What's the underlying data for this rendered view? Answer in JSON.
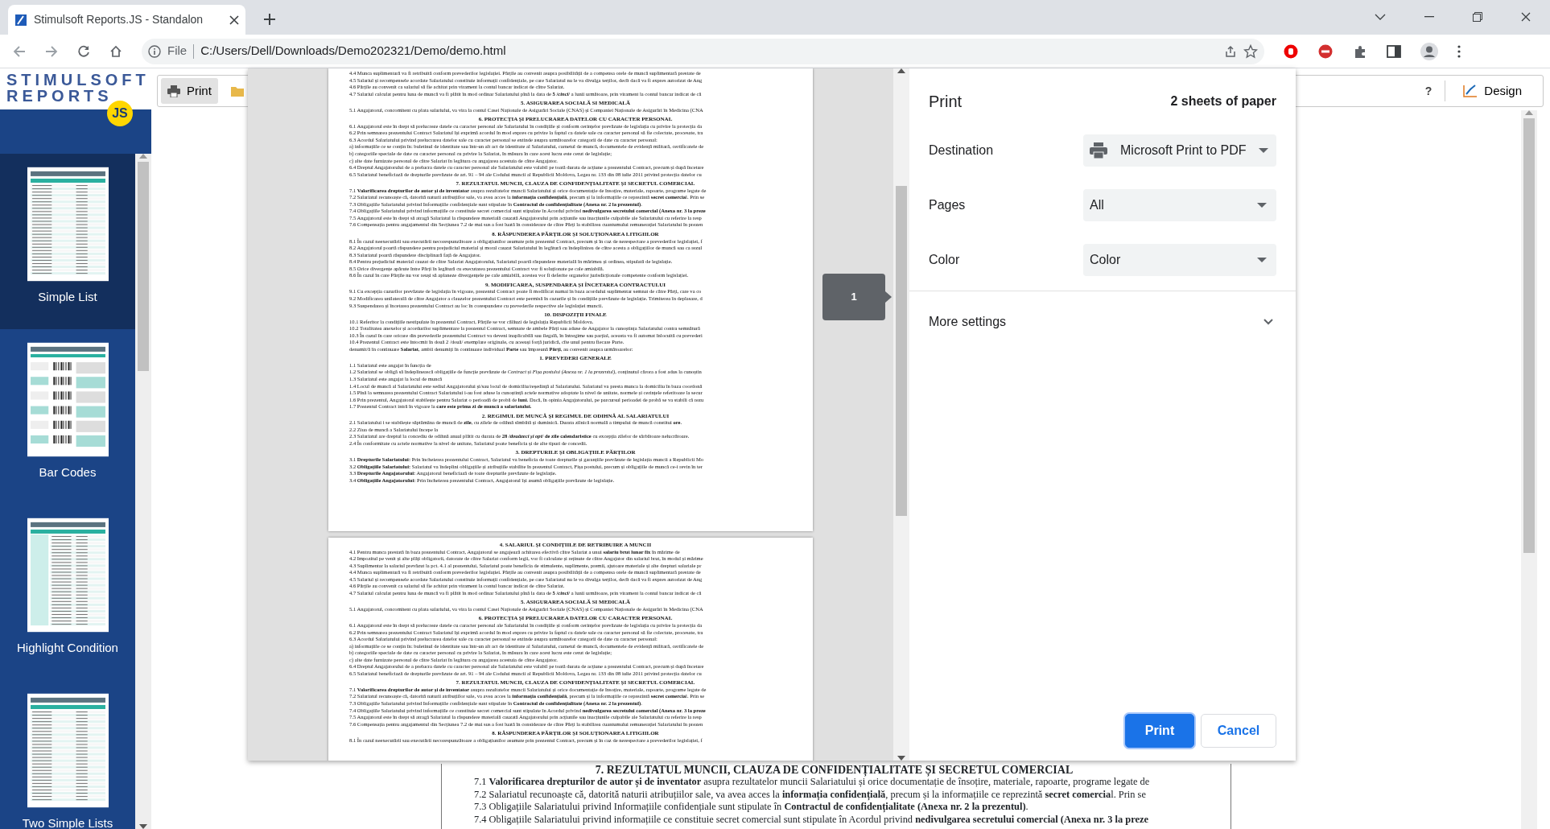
{
  "browser": {
    "tab_title": "Stimulsoft Reports.JS - Standalon",
    "scheme": "File",
    "url": "C:/Users/Dell/Downloads/Demo202321/Demo/demo.html"
  },
  "sidebar": {
    "logo_line1": "STIMULSOFT",
    "logo_line2": "REPORTS",
    "logo_badge": "JS",
    "items": [
      {
        "label": "Simple List",
        "selected": true,
        "kind": "list"
      },
      {
        "label": "Bar Codes",
        "selected": false,
        "kind": "barcodes"
      },
      {
        "label": "Highlight Condition",
        "selected": false,
        "kind": "grouped"
      },
      {
        "label": "Two Simple Lists",
        "selected": false,
        "kind": "list"
      }
    ]
  },
  "toolbar": {
    "print": "Print",
    "help": "?",
    "design": "Design"
  },
  "document": {
    "lines": [
      {
        "kind": "heading",
        "text": "7. REZULTATUL MUNCII, CLAUZA DE CONFIDENȚIALITATE ȘI SECRETUL COMERCIAL"
      },
      {
        "kind": "text",
        "text": "7.1 **Valorificarea drepturilor de autor și de inventator** asupra rezultatelor muncii Salariatului și orice documentație de însoțire, materiale, rapoarte, programe legate de"
      },
      {
        "kind": "text",
        "text": "7.2 Salariatul recunoaște că, datorită naturii atribuțiilor sale, va avea acces la **informația confidențială**, precum și la informațiile ce reprezintă **secret comercia**l. Prin se"
      },
      {
        "kind": "text",
        "text": "7.3 Obligațiile Salariatului privind Informațiile confidențiale sunt stipulate în **Contractul de confidențialitate (Anexa nr. 2 la prezentul)**."
      },
      {
        "kind": "text",
        "text": "7.4 Obligațiile Salariatului privind informațiile ce constituie secret comercial sunt stipulate în Acordul privind **nedivulgarea secretului comercial (Anexa nr. 3 la preze**"
      }
    ]
  },
  "print_preview": {
    "page_number": "1",
    "pages": [
      {
        "lines": [
          {
            "kind": "text",
            "text": "4.4 Munca suplimentară va fi retribuită conform prevederilor legislației. Părțile au convenit asupra posibilității de a compensa orele de muncă suplimentară prestate de"
          },
          {
            "kind": "text",
            "text": "4.5 Salariul și recompensele acordate Salariatului constituie informații confidențiale, pe care Salariatul nu le va divulga terților, decît dacă va fi expres autorizat de Ang"
          },
          {
            "kind": "text",
            "text": "4.6 Părțile au convenit ca salariul să fie achitat prin virament la contul bancar indicat de către Salariat."
          },
          {
            "kind": "text",
            "text": "4.7 Salariul calculat pentru luna de muncă va fi plătit în mod ordinar Salariatului pînă la data de **5 /*cinci*/** a lunii următoare, prin virament la contul bancar indicat de că"
          },
          {
            "kind": "heading",
            "text": "5. ASIGURAREA SOCIALĂ SI MEDICALĂ"
          },
          {
            "kind": "text",
            "text": "5.1 Angajatorul, concomitent cu plata salariului, va vira la contul Casei Naționale de Asigurări Sociale (CNAS) și Companiei Naționale de Asigurări în Medicina (CNA"
          },
          {
            "kind": "heading",
            "text": "6. PROTECȚIA ȘI PRELUCRAREA DATELOR CU CARACTER PERSONAL"
          },
          {
            "kind": "text",
            "text": "6.1 Angajatorul este în drept să prelucreze datele cu caracter personal ale Salariatului în condițiile și conform cerințelor prevăzute de legislația cu privire la protecția da"
          },
          {
            "kind": "text",
            "text": "6.2 Prin semnarea prezentului Contract Salariatul își exprimă acordul în mod expres cu privire la faptul ca datele sale cu caracter personal să fie colectate, procesate, tra"
          },
          {
            "kind": "text",
            "text": "6.3 Acordul Salariatului privind prelucrarea datelor sale cu caracter personal se extinde asupra următoarelor categorii de date cu caracter personal:"
          },
          {
            "kind": "text",
            "text": "a) informațiile ce se conțin în: buletinul de identitate sau într-un alt act de identitate al Salariatului, carnetul de muncă, documentele de evidență militară, certificatele de"
          },
          {
            "kind": "text",
            "text": "b) categoriile speciale de date cu caracter personal cu privire la Salariat, în măsura în care acest lucru este cerut de legislație;"
          },
          {
            "kind": "text",
            "text": "c) alte date furnizate personal de către Salariat în legătura cu angajarea acestuia de către Angajator."
          },
          {
            "kind": "text",
            "text": "6.4 Dreptul Angajatorului de a prelucra datele cu caracter personal ale Salariatului este valabil pe toată durata de acțiune a prezentului Contract, precum și după încetare"
          },
          {
            "kind": "text",
            "text": "6.5 Salariatul beneficiază de drepturile prevăzute de art. 91 – 94 ale Codului muncii al Republicii Moldova, Legea nr. 133 din 08 iulie 2011 privind protecția datelor cu"
          },
          {
            "kind": "heading",
            "text": "7. REZULTATUL MUNCII, CLAUZA DE CONFIDENȚIALITATE ȘI SECRETUL COMERCIAL"
          },
          {
            "kind": "text",
            "text": "7.1 **Valorificarea drepturilor de autor și de inventator** asupra rezultatelor muncii Salariatului și orice documentație de însoțire, materiale, rapoarte, programe legate de"
          },
          {
            "kind": "text",
            "text": "7.2 Salariatul recunoaște că, datorită naturii atribuțiilor sale, va avea acces la **informația confidențială**, precum și la informațiile ce reprezintă **secret comercia**l. Prin se"
          },
          {
            "kind": "text",
            "text": "7.3 Obligațiile Salariatului privind Informațiile confidențiale sunt stipulate în **Contractul de confidențialitate (Anexa nr. 2 la prezentul)**."
          },
          {
            "kind": "text",
            "text": "7.4 Obligațiile Salariatului privind informațiile ce constituie secret comercial sunt stipulate în Acordul privind **nedivulgarea secretului comercial (Anexa nr. 3 la preze**"
          },
          {
            "kind": "text",
            "text": "7.5 Angajatorul este în drept să atragă Salariatul la răspundere materială cauzată Angajatorului prin acțiunile sau inacțiunile culpabile ale Salariatului cu referire la resp"
          },
          {
            "kind": "text",
            "text": "7.6 Compensația pentru angajamentul din Secțiunea 7.2 de mai sus a fost luată în considerare de către Părți la stabilirea cuantumului remunerației Salariatului în prezen"
          },
          {
            "kind": "heading",
            "text": "8. RĂSPUNDEREA PĂRȚILOR ȘI SOLUȚIONAREA LITIGIILOR"
          },
          {
            "kind": "text",
            "text": "8.1 În cazul neexecutării sau executării necorespunzătoare a obligațiunilor asumate prin prezentul Contract, precum și în caz de nerespectare a prevederilor legislației, f"
          },
          {
            "kind": "text",
            "text": "8.2 Angajatorul poartă răspundere pentru prejudiciul material și moral cauzat Salariatului în legătură cu îndeplinirea de către acesta a obligațiilor de muncă sau ca rezul"
          },
          {
            "kind": "text",
            "text": "8.3 Salariatul poartă răspundere disciplinară față de Angajator."
          },
          {
            "kind": "text",
            "text": "8.4 Pentru prejudiciul material cauzat de către Salariat Angajatorului, Salariatul poartă răspundere materială în mărimea și ordinea, stipulată de legislație."
          },
          {
            "kind": "text",
            "text": "8.5 Orice divergențe apărute între Părți în legătură cu executarea prezentului Contract vor fi soluționate pe cale amiabilă."
          },
          {
            "kind": "text",
            "text": "8.6 În cazul în care Părțile nu vor reuși să aplaneze divergențele pe cale amiabilă, acestea vor fi deferite organelor jurisdicționale competente conform legislației."
          },
          {
            "kind": "heading",
            "text": "9. MODIFICAREA, SUSPENDAREA ȘI ÎNCETAREA CONTRACTULUI"
          },
          {
            "kind": "text",
            "text": "9.1 Cu excepția cazurilor prevăzute de legislația în vigoare, prezentul Contract poate fi modificat numai în baza acordului suplimentar semnat de către Părți, care va co"
          },
          {
            "kind": "text",
            "text": "9.2 Modificarea unilaterală de către Angajator a clauzelor prezentului Contract este permisă în cazurile și în condițiile prevăzute de legislație. Trimiterea în deplasare, d"
          },
          {
            "kind": "text",
            "text": "9.3 Suspendarea și încetarea prezentului Contract au loc în corespundere cu prevederile respective ale legislației muncii."
          },
          {
            "kind": "heading",
            "text": "10. DISPOZIȚII FINALE"
          },
          {
            "kind": "text",
            "text": "10.1 Referitor la condițiile nestipulate în prezentul Contract, Părțile se vor călăuzi de legislația Republicii Moldova."
          },
          {
            "kind": "text",
            "text": "10.2 Totalitatea anexelor și acordurilor suplimentare la prezentul Contract, semnate de ambele Părți sau aduse de Angajator la cunoștința Salariatului contra semnătură"
          },
          {
            "kind": "text",
            "text": "10.3 În cazul în care oricare din prevederile prezentului Contract va deveni inaplicabilă sau ilegală, în întregime sau parțial, aceasta va fi automat înlocuită cu prevederi"
          },
          {
            "kind": "text",
            "text": "10.4 Prezentul Contract este întocmit în două 2 /două/ exemplare originale, cu aceeași forță juridică, cîte unul pentru fiecare Parte."
          },
          {
            "kind": "text",
            "text": "denumit/ă în continuare **Salariat**, ambii denumiți în continuare individual **Parte** sau împreună **Părți**, au convenit asupra următoarelor:"
          },
          {
            "kind": "heading",
            "text": "1. PREVEDERI GENERALE"
          },
          {
            "kind": "text",
            "text": "1.1 Salariatul este angajat în funcția de"
          },
          {
            "kind": "text",
            "text": "1.2 Salariatul se obligă să îndeplinească obligațiile de funcție prevăzute de *Contract* și *Fișa postului (Anexa nr. 1 la prezentul)*, conținutul cărora a fost adus la cunoștin"
          },
          {
            "kind": "text",
            "text": "1.3 Salariatul este angajat la locul de muncă"
          },
          {
            "kind": "text",
            "text": "1.4 Locul de muncă al Salariatului este sediul Angajatorului și/sau locul de domiciliu/reședință al Salariatului. Salariatul va presta munca la domiciliu în baza coordonă"
          },
          {
            "kind": "text",
            "text": "1.5 Pînă la semnarea prezentului Contract Salariatului i-au fost aduse la cunoștință actele normative adoptate la nivel de unitate, normele și cerințele referitoare la secur"
          },
          {
            "kind": "text",
            "text": "1.6 Prin prezentul, Angajatorul stabilește pentru Salariat o perioadă de probă de **luni**. Dacă, în opinia Angajatorului, pe parcursul perioadei de probă se va stabili că rezu"
          },
          {
            "kind": "text",
            "text": "1.7 Prezentul Contract intră în vigoare la **care este prima zi de muncă a salariatului.**"
          },
          {
            "kind": "heading",
            "text": "2. REGIMUL DE MUNCĂ ȘI REGIMUL DE ODIHNĂ AL SALARIATULUI"
          },
          {
            "kind": "text",
            "text": "2.1 Salariatului i se stabilește săptămâna de muncă de **zile**, cu zilele de odihnă sîmbătă și duminică. Durata zilnică normală a timpului de muncă constitui **ore**."
          },
          {
            "kind": "text",
            "text": "2.2 Ziua de muncă a Salariatului începe la"
          },
          {
            "kind": "text",
            "text": "2.3 Salariatul are dreptul la concediu de odihnă anual plătit cu durata de **28 /*douăzeci și opt*/ de zile calendaristice** cu excepția zilelor de sărbătoare nelucrătoare."
          },
          {
            "kind": "text",
            "text": "2.4 În conformitate cu actele normative la nivel de unitate, Salariatul poate beneficia și de alte tipuri de concedii."
          },
          {
            "kind": "heading",
            "text": "3. DREPTURILE ȘI OBLIGAȚIILE PĂRȚILOR"
          },
          {
            "kind": "text",
            "text": "3.1 **Drepturile Salariatului:** Prin încheierea prezentului Contract, Salariatul va beneficia de toate drepturile și garanțiile prevăzute de legislația muncii a Republicii Mo"
          },
          {
            "kind": "text",
            "text": "3.2 **Obligațiile Salariatului:** Salariatul va îndeplini obligațiile și atribuțiile stabilite în prezentul Contract, Fișa postului, precum și obligațiile de muncă ce-i revin în ter"
          },
          {
            "kind": "text",
            "text": "3.3 **Drepturile Angajatorului:** Angajatorul beneficiază de toate drepturile prevăzute de legislație."
          },
          {
            "kind": "text",
            "text": "3.4 **Obligațiile Angajatorului:** Prin încheierea prezentului Contract, Angajatorul își asumă obligațiile prevăzute de legislație."
          }
        ]
      },
      {
        "lines": [
          {
            "kind": "heading",
            "text": "4. SALARIUL ȘI CONDIȚIILE DE RETRIBUIRE A MUNCII"
          },
          {
            "kind": "text",
            "text": "4.1 Pentru munca prestată în baza prezentului Contract, Angajatorul se angajează achitarea efectivă către Salariat a unui **salariu brut lunar fix** în mărime de"
          },
          {
            "kind": "text",
            "text": "4.2 Impozitul pe venit și alte plăți obligatorii, datorate de către Salariat conform legii, vor fi calculate și reținute de către Angajator din salariul brut, în modul și mărime"
          },
          {
            "kind": "text",
            "text": "4.3 Suplimentar la salariul prevăzut la pct. 4.1 al prezentului, Salariatul poate beneficia de stimulente, suplimente, premii, ajutoare materiale și alte drepturi salariale pr"
          },
          {
            "kind": "text",
            "text": "4.4 Munca suplimentară va fi retribuită conform prevederilor legislației. Părțile au convenit asupra posibilității de a compensa orele de muncă suplimentară prestate de"
          },
          {
            "kind": "text",
            "text": "4.5 Salariul și recompensele acordate Salariatului constituie informații confidențiale, pe care Salariatul nu le va divulga terților, decît dacă va fi expres autorizat de Ang"
          },
          {
            "kind": "text",
            "text": "4.6 Părțile au convenit ca salariul să fie achitat prin virament la contul bancar indicat de către Salariat."
          },
          {
            "kind": "text",
            "text": "4.7 Salariul calculat pentru luna de muncă va fi plătit în mod ordinar Salariatului pînă la data de **5 /*cinci*/** a lunii următoare, prin virament la contul bancar indicat de că"
          },
          {
            "kind": "heading",
            "text": "5. ASIGURAREA SOCIALĂ SI MEDICALĂ"
          },
          {
            "kind": "text",
            "text": "5.1 Angajatorul, concomitent cu plata salariului, va vira la contul Casei Naționale de Asigurări Sociale (CNAS) și Companiei Naționale de Asigurări în Medicina (CNA"
          },
          {
            "kind": "heading",
            "text": "6. PROTECȚIA ȘI PRELUCRAREA DATELOR CU CARACTER PERSONAL"
          },
          {
            "kind": "text",
            "text": "6.1 Angajatorul este în drept să prelucreze datele cu caracter personal ale Salariatului în condițiile și conform cerințelor prevăzute de legislația cu privire la protecția da"
          },
          {
            "kind": "text",
            "text": "6.2 Prin semnarea prezentului Contract Salariatul își exprimă acordul în mod expres cu privire la faptul ca datele sale cu caracter personal să fie colectate, procesate, tra"
          },
          {
            "kind": "text",
            "text": "6.3 Acordul Salariatului privind prelucrarea datelor sale cu caracter personal se extinde asupra următoarelor categorii de date cu caracter personal:"
          },
          {
            "kind": "text",
            "text": "a) informațiile ce se conțin în: buletinul de identitate sau într-un alt act de identitate al Salariatului, carnetul de muncă, documentele de evidență militară, certificatele de"
          },
          {
            "kind": "text",
            "text": "b) categoriile speciale de date cu caracter personal cu privire la Salariat, în măsura în care acest lucru este cerut de legislație;"
          },
          {
            "kind": "text",
            "text": "c) alte date furnizate personal de către Salariat în legătura cu angajarea acestuia de către Angajator."
          },
          {
            "kind": "text",
            "text": "6.4 Dreptul Angajatorului de a prelucra datele cu caracter personal ale Salariatului este valabil pe toată durata de acțiune a prezentului Contract, precum și după încetare"
          },
          {
            "kind": "text",
            "text": "6.5 Salariatul beneficiază de drepturile prevăzute de art. 91 – 94 ale Codului muncii al Republicii Moldova, Legea nr. 133 din 08 iulie 2011 privind protecția datelor cu"
          },
          {
            "kind": "heading",
            "text": "7. REZULTATUL MUNCII, CLAUZA DE CONFIDENȚIALITATE ȘI SECRETUL COMERCIAL"
          },
          {
            "kind": "text",
            "text": "7.1 **Valorificarea drepturilor de autor și de inventator** asupra rezultatelor muncii Salariatului și orice documentație de însoțire, materiale, rapoarte, programe legate de"
          },
          {
            "kind": "text",
            "text": "7.2 Salariatul recunoaște că, datorită naturii atribuțiilor sale, va avea acces la **informația confidențială**, precum și la informațiile ce reprezintă **secret comercia**l. Prin se"
          },
          {
            "kind": "text",
            "text": "7.3 Obligațiile Salariatului privind Informațiile confidențiale sunt stipulate în **Contractul de confidențialitate (Anexa nr. 2 la prezentul)**."
          },
          {
            "kind": "text",
            "text": "7.4 Obligațiile Salariatului privind informațiile ce constituie secret comercial sunt stipulate în Acordul privind **nedivulgarea secretului comercial (Anexa nr. 3 la preze**"
          },
          {
            "kind": "text",
            "text": "7.5 Angajatorul este în drept să atragă Salariatul la răspundere materială cauzată Angajatorului prin acțiunile sau inacțiunile culpabile ale Salariatului cu referire la resp"
          },
          {
            "kind": "text",
            "text": "7.6 Compensația pentru angajamentul din Secțiunea 7.2 de mai sus a fost luată în considerare de către Părți la stabilirea cuantumului remunerației Salariatului în prezen"
          },
          {
            "kind": "heading",
            "text": "8. RĂSPUNDEREA PĂRȚILOR ȘI SOLUȚIONAREA LITIGIILOR"
          },
          {
            "kind": "text",
            "text": "8.1 În cazul neexecutării sau executării necorespunzătoare a obligațiunilor asumate prin prezentul Contract, precum și în caz de nerespectare a prevederilor legislației, f"
          }
        ]
      }
    ]
  },
  "print_dialog": {
    "title": "Print",
    "summary": "2 sheets of paper",
    "settings": [
      {
        "label": "Destination",
        "value": "Microsoft Print to PDF",
        "kind": "printer"
      },
      {
        "label": "Pages",
        "value": "All",
        "kind": "plain"
      },
      {
        "label": "Color",
        "value": "Color",
        "kind": "plain"
      }
    ],
    "more_settings": {
      "label": "More settings",
      "expanded": false
    },
    "buttons": [
      {
        "label": "Print",
        "kind": "primary"
      },
      {
        "label": "Cancel",
        "kind": "secondary"
      }
    ]
  }
}
